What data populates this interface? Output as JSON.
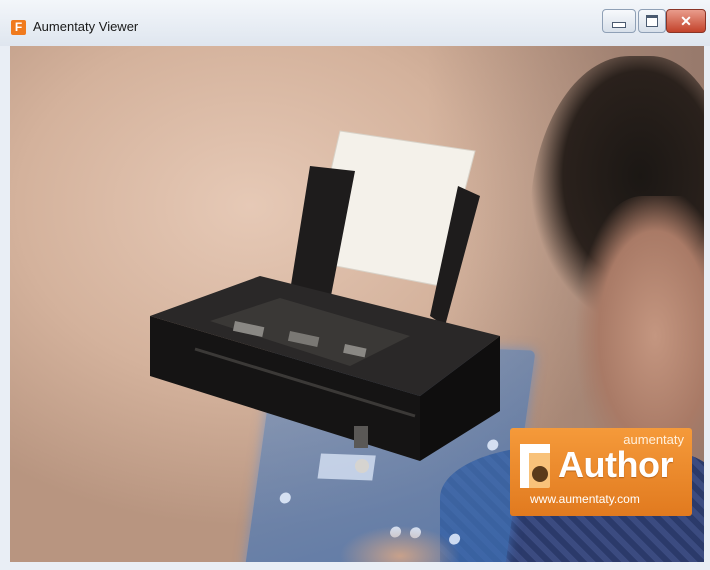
{
  "window": {
    "title": "Aumentaty Viewer",
    "app_icon": "F",
    "controls": {
      "minimize_icon": "minimize-icon",
      "maximize_icon": "maximize-icon",
      "close_glyph": "✕"
    }
  },
  "viewport": {
    "model": "printer-3d-model",
    "marker": "ar-marker-card"
  },
  "badge": {
    "small_text": "aumentaty",
    "big_text": "Author",
    "url": "www.aumentaty.com",
    "colors": {
      "accent": "#f07a1d",
      "text": "#ffffff"
    }
  }
}
